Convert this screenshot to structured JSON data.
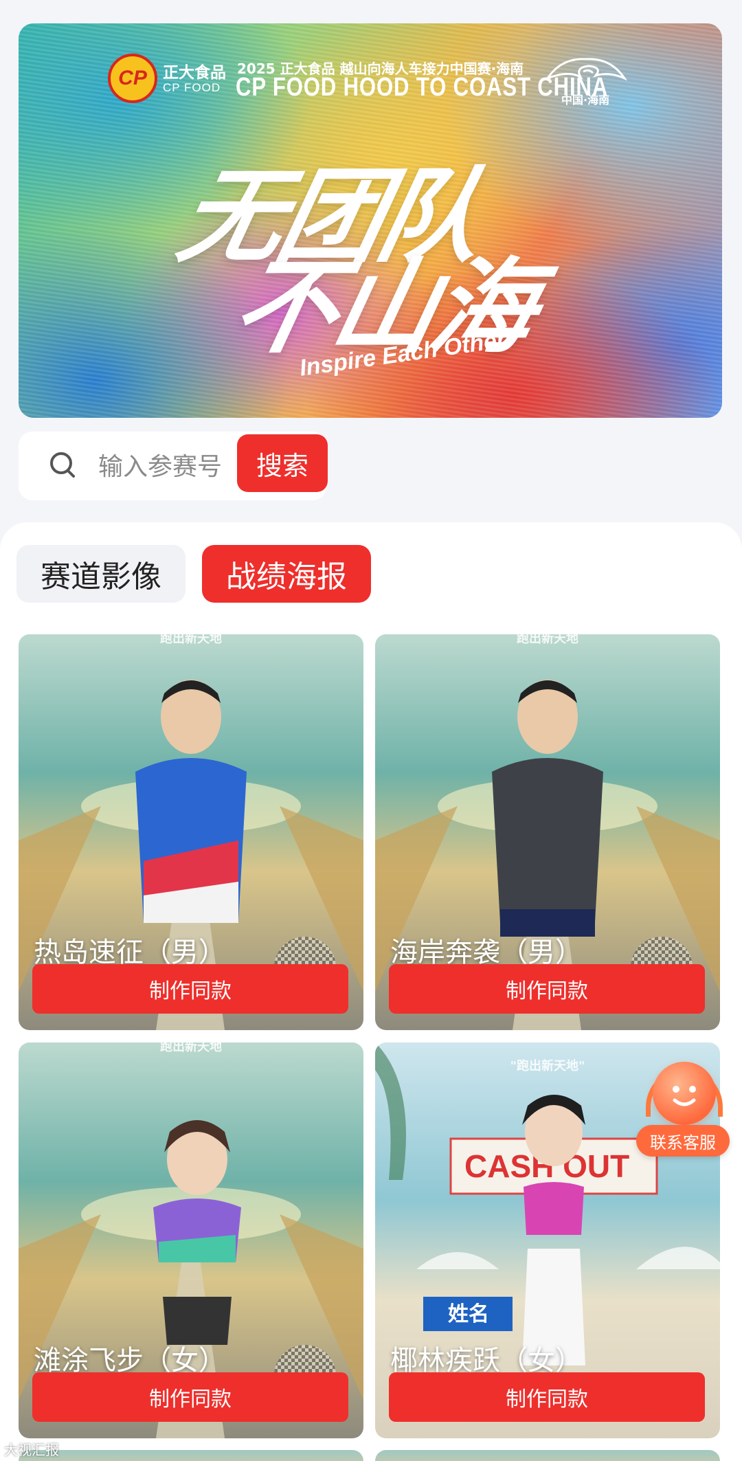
{
  "banner": {
    "brand_cn": "正大食品",
    "brand_en": "CP FOOD",
    "logo_mark": "CP",
    "event_cn": "2025 正大食品 越山向海人车接力中国赛·海南",
    "event_en": "CP FOOD HOOD TO COAST CHINA",
    "region": "中国·海南",
    "slogan_line1": "无团队",
    "slogan_line2": "不山海",
    "slogan_en": "Inspire Each Other"
  },
  "search": {
    "placeholder": "输入参赛号",
    "button_label": "搜索"
  },
  "tabs": [
    {
      "label": "赛道影像",
      "active": false
    },
    {
      "label": "战绩海报",
      "active": true
    }
  ],
  "cards": [
    {
      "title": "热岛速征（男）",
      "button": "制作同款",
      "top_tag": "跑出新天地"
    },
    {
      "title": "海岸奔袭（男）",
      "button": "制作同款",
      "top_tag": "跑出新天地"
    },
    {
      "title": "滩涂飞步（女）",
      "button": "制作同款",
      "top_tag": "跑出新天地"
    },
    {
      "title": "椰林疾跃（女）",
      "button": "制作同款",
      "top_tag": "\"跑出新天地\""
    }
  ],
  "service": {
    "label": "联系客服"
  },
  "watermark": "大视汇报",
  "colors": {
    "accent": "#ee2f2c",
    "service": "#ff6a3d"
  }
}
